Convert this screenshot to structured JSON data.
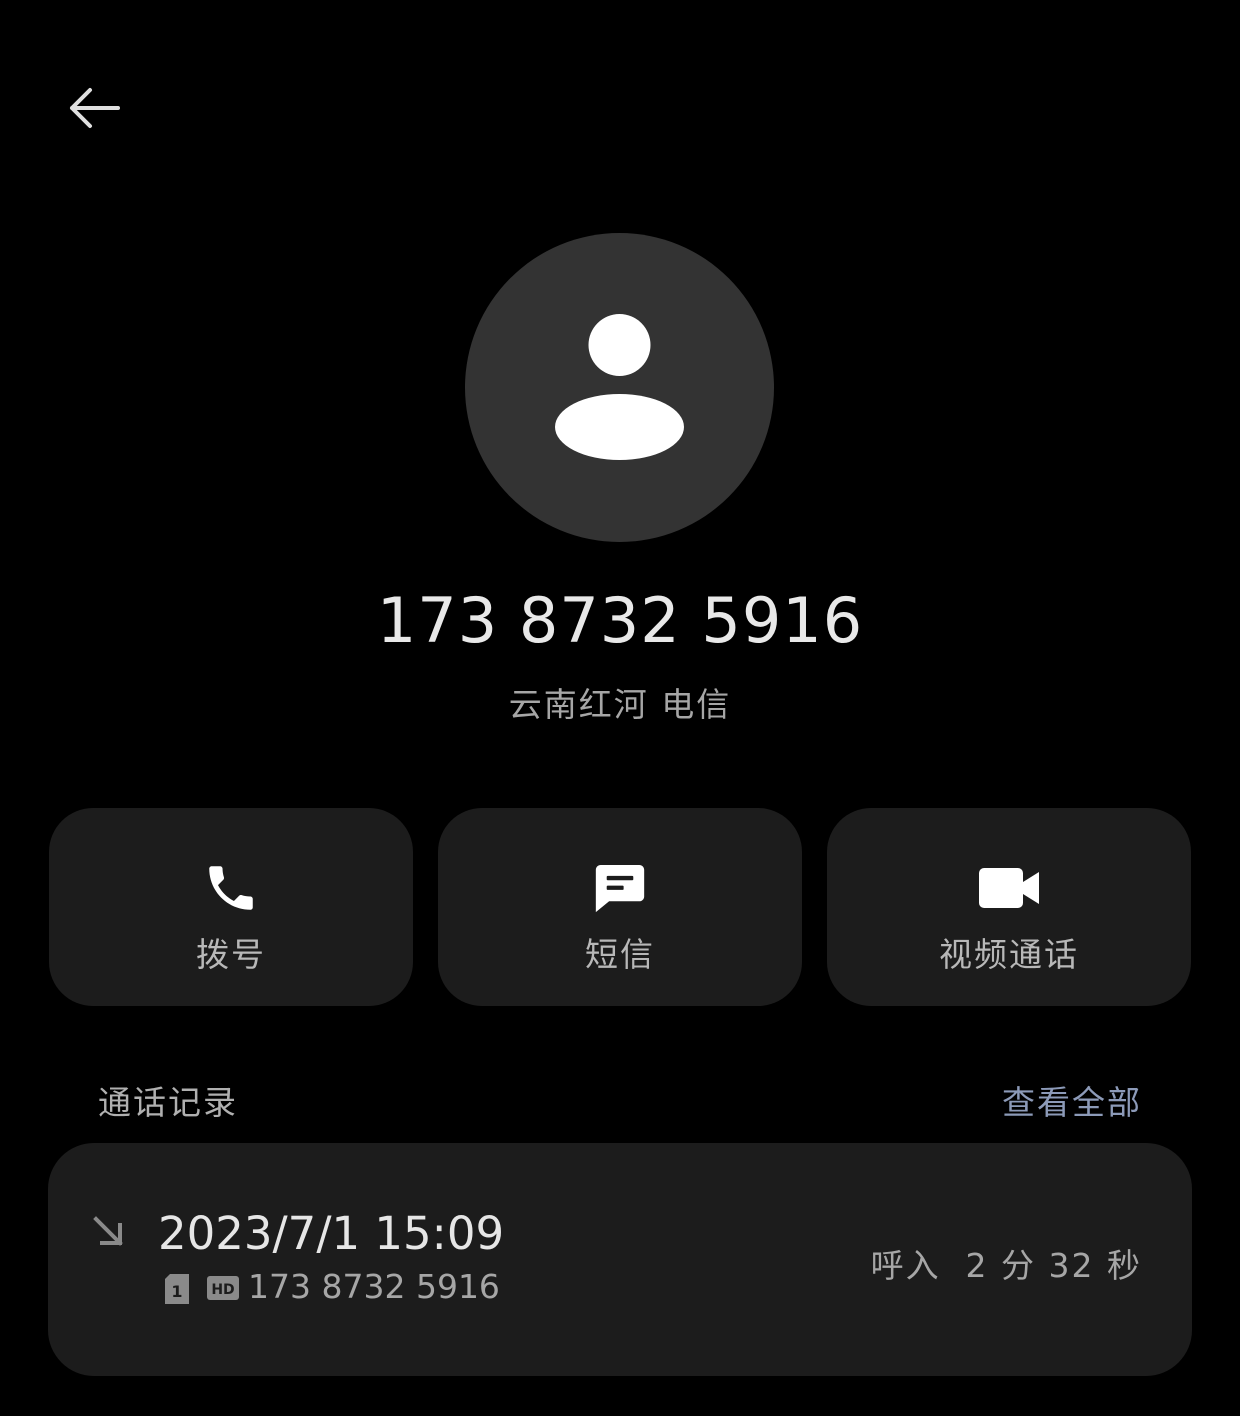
{
  "header": {
    "back_icon": "arrow-left-icon"
  },
  "contact": {
    "avatar_icon": "person-icon",
    "number": "173 8732 5916",
    "location": "云南红河 电信"
  },
  "actions": [
    {
      "icon": "phone-icon",
      "label": "拨号"
    },
    {
      "icon": "message-icon",
      "label": "短信"
    },
    {
      "icon": "video-camera-icon",
      "label": "视频通话"
    }
  ],
  "call_log": {
    "title": "通话记录",
    "view_all": "查看全部",
    "entries": [
      {
        "direction_icon": "incoming-call-arrow-icon",
        "datetime": "2023/7/1 15:09",
        "sim": "1",
        "hd_badge": "HD",
        "number": "173 8732 5916",
        "summary": "呼入  2 分 32 秒"
      }
    ]
  },
  "colors": {
    "background": "#000000",
    "card": "#1c1c1c",
    "avatar_bg": "#333333",
    "accent_link": "#8c9ab8"
  }
}
